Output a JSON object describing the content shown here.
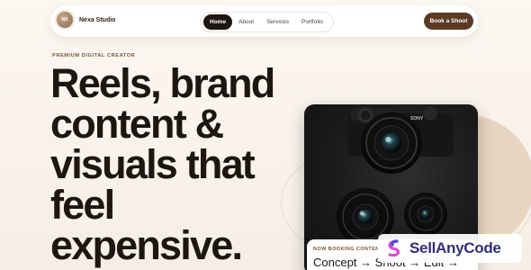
{
  "brand": {
    "logo_initials": "NX",
    "name": "Nexa Studio"
  },
  "nav": {
    "items": [
      {
        "label": "Home",
        "active": true
      },
      {
        "label": "About",
        "active": false
      },
      {
        "label": "Services",
        "active": false
      },
      {
        "label": "Portfolio",
        "active": false
      }
    ]
  },
  "cta": {
    "label": "Book a Shoot"
  },
  "hero": {
    "eyebrow": "PREMIUM DIGITAL CREATOR",
    "headline_lines": [
      "Reels, brand",
      "content &",
      "visuals that",
      "feel",
      "expensive."
    ]
  },
  "photo_card": {
    "camera_brand": "SONY",
    "booking_label": "NOW BOOKING CONTEN",
    "booking_flow": "Concept → Shoot → Edit →"
  },
  "watermark": {
    "text": "SellAnyCode",
    "icon": "sellanycode-logo-icon"
  },
  "colors": {
    "background": "#f7f0e7",
    "accent_brown": "#5a3a22",
    "nav_active": "#1f1611",
    "eyebrow": "#7a5235",
    "headline": "#1d1611"
  }
}
